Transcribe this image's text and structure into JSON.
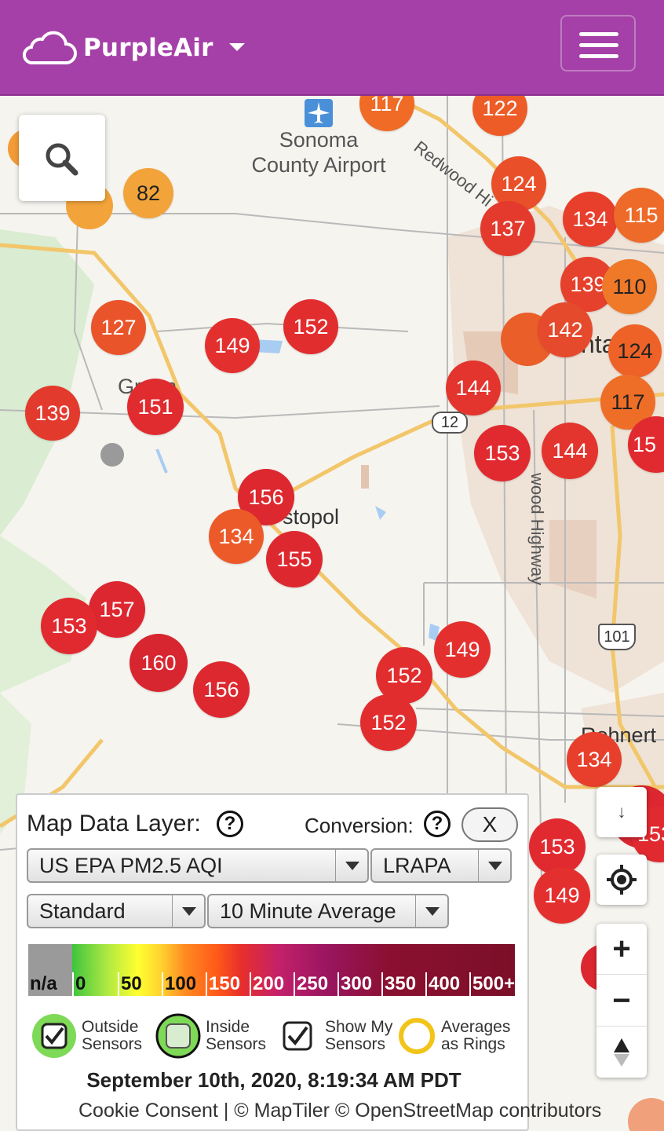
{
  "header": {
    "brand": "PurpleAir"
  },
  "map": {
    "places": {
      "airport": "Sonoma\nCounty Airport",
      "graton": "Gr    n",
      "sebastopol": "stopol",
      "road_redwood": "Redwood Hi",
      "road_redwood2": "wood Highway",
      "rohnert": "Rohnert",
      "highway12": "12",
      "highway101": "101",
      "santa": "nta"
    },
    "sensors": [
      {
        "v": "117",
        "c": "#ef6b26"
      },
      {
        "v": "122",
        "c": "#ed5c27"
      },
      {
        "v": "82",
        "c": "#f2a33a"
      },
      {
        "v": "124",
        "c": "#e9502a"
      },
      {
        "v": "137",
        "c": "#e33a2d"
      },
      {
        "v": "134",
        "c": "#e73f2c"
      },
      {
        "v": "115",
        "c": "#ee6a28"
      },
      {
        "v": "139",
        "c": "#e6412c"
      },
      {
        "v": "110",
        "c": "#ef7829"
      },
      {
        "v": "127",
        "c": "#e9542a"
      },
      {
        "v": "152",
        "c": "#e22d2f"
      },
      {
        "v": "149",
        "c": "#e3302f"
      },
      {
        "v": "142",
        "c": "#e64a2c"
      },
      {
        "v": "124",
        "c": "#ee6228"
      },
      {
        "v": "144",
        "c": "#e3342e"
      },
      {
        "v": "139",
        "c": "#e33a2e"
      },
      {
        "v": "151",
        "c": "#e02c2f"
      },
      {
        "v": "117",
        "c": "#ef6e27"
      },
      {
        "v": "153",
        "c": "#e12a30"
      },
      {
        "v": "144",
        "c": "#e3342e"
      },
      {
        "v": "15",
        "c": "#e12a30"
      },
      {
        "v": "156",
        "c": "#dd2830"
      },
      {
        "v": "134",
        "c": "#ec5a29"
      },
      {
        "v": "155",
        "c": "#de2830"
      },
      {
        "v": "157",
        "c": "#dc2730"
      },
      {
        "v": "153",
        "c": "#e12a30"
      },
      {
        "v": "160",
        "c": "#d72630"
      },
      {
        "v": "156",
        "c": "#dd2830"
      },
      {
        "v": "149",
        "c": "#e3302f"
      },
      {
        "v": "152",
        "c": "#e22d2f"
      },
      {
        "v": "152",
        "c": "#e22d2f"
      },
      {
        "v": "134",
        "c": "#e73f2c"
      },
      {
        "v": "153",
        "c": "#e12a30"
      },
      {
        "v": "149",
        "c": "#e3302f"
      },
      {
        "v": "153",
        "c": "#e12a30"
      }
    ]
  },
  "panel": {
    "map_data_layer_label": "Map Data Layer:",
    "conversion_label": "Conversion:",
    "close_label": "X",
    "help_glyph": "?",
    "layer_select": "US EPA PM2.5 AQI",
    "conversion_select": "LRAPA",
    "standard_select": "Standard",
    "average_select": "10 Minute Average",
    "scale_labels": [
      "n/a",
      "0",
      "50",
      "100",
      "150",
      "200",
      "250",
      "300",
      "350",
      "400",
      "500+"
    ],
    "checks": {
      "outside": "Outside\nSensors",
      "inside": "Inside\nSensors",
      "mine": "Show My\nSensors",
      "rings": "Averages\nas Rings"
    },
    "timestamp": "September 10th, 2020, 8:19:34 AM PDT"
  },
  "attribution": "Cookie Consent | © MapTiler © OpenStreetMap contributors",
  "controls": {
    "download": "↓",
    "zoom_in": "+",
    "zoom_out": "−"
  }
}
